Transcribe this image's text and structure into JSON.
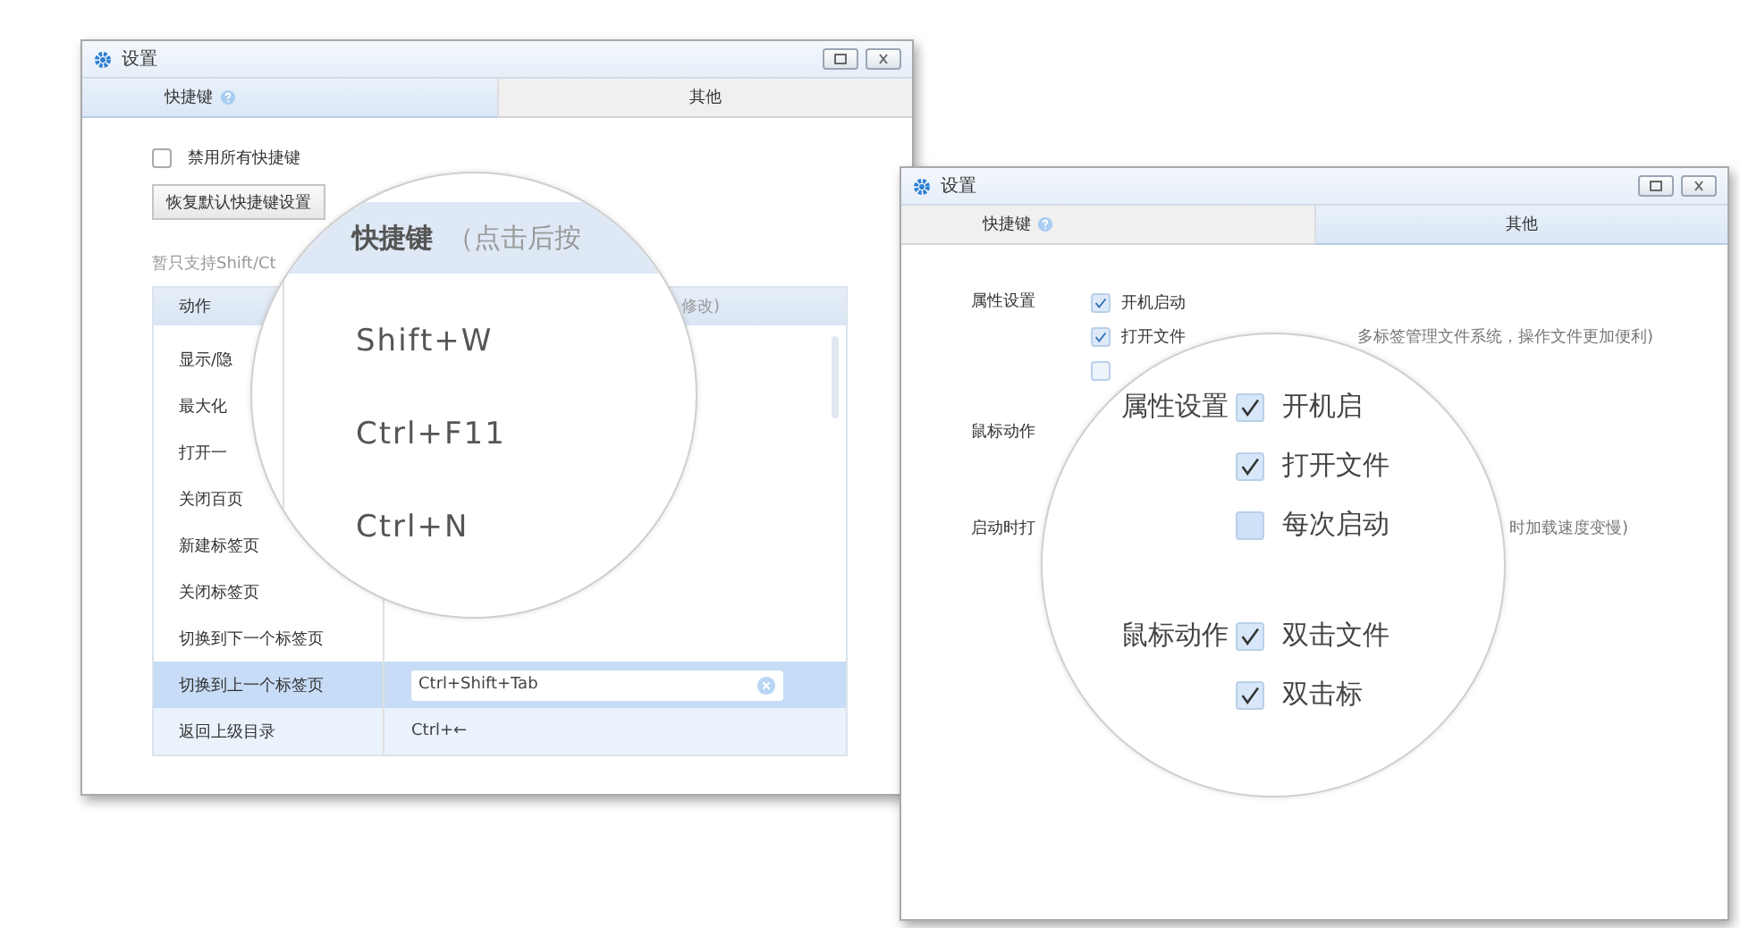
{
  "shortcut_window": {
    "title": "设置",
    "tabs": [
      {
        "label": "快捷键",
        "help_icon": true,
        "selected": true
      },
      {
        "label": "其他",
        "help_icon": false,
        "selected": false
      }
    ],
    "disable_all": {
      "label": "禁用所有快捷键",
      "checked": false
    },
    "restore_button": "恢复默认快捷键设置",
    "note": "暂只支持Shift/Ct",
    "table": {
      "columns": [
        "动作",
        "修改)"
      ],
      "rows": [
        {
          "action": "显示/隐",
          "selected": false,
          "hovered": false
        },
        {
          "action": "最大化",
          "selected": false,
          "hovered": false
        },
        {
          "action": "打开一",
          "selected": false,
          "hovered": false
        },
        {
          "action": "关闭百页",
          "selected": false,
          "hovered": false
        },
        {
          "action": "新建标签页",
          "selected": false,
          "hovered": false
        },
        {
          "action": "关闭标签页",
          "selected": false,
          "hovered": false
        },
        {
          "action": "切换到下一个标签页",
          "selected": false,
          "hovered": false
        },
        {
          "action": "切换到上一个标签页",
          "shortcut": "Ctrl+Shift+Tab",
          "selected": true,
          "hovered": false
        },
        {
          "action": "返回上级目录",
          "shortcut": "Ctrl+←",
          "selected": false,
          "hovered": true
        }
      ]
    },
    "magnifier": {
      "header": "快捷键",
      "header_hint": "（点击后按",
      "values": [
        "Shift+W",
        "Ctrl+F11",
        "Ctrl+N"
      ]
    }
  },
  "other_window": {
    "title": "设置",
    "tabs": [
      {
        "label": "快捷键",
        "help_icon": true,
        "selected": false
      },
      {
        "label": "其他",
        "help_icon": false,
        "selected": true
      }
    ],
    "sections": [
      {
        "label": "属性设置",
        "options": [
          {
            "label": "开机启动",
            "checked": true
          },
          {
            "label": "打开文件",
            "checked": true,
            "hint": "多标签管理文件系统，操作文件更加便利)"
          },
          {
            "checked": false
          }
        ]
      },
      {
        "label": "鼠标动作"
      },
      {
        "label": "启动时打",
        "hint": "时加载速度变慢)"
      }
    ],
    "magnifier": {
      "sections": [
        {
          "label": "属性设置",
          "options": [
            {
              "label": "开机启",
              "checked": true
            },
            {
              "label": "打开文件",
              "checked": true
            },
            {
              "label": "每次启动",
              "checked": false
            }
          ]
        },
        {
          "label": "鼠标动作",
          "options": [
            {
              "label": "双击文件",
              "checked": true
            },
            {
              "label": "双击标",
              "checked": true
            }
          ]
        }
      ]
    }
  }
}
